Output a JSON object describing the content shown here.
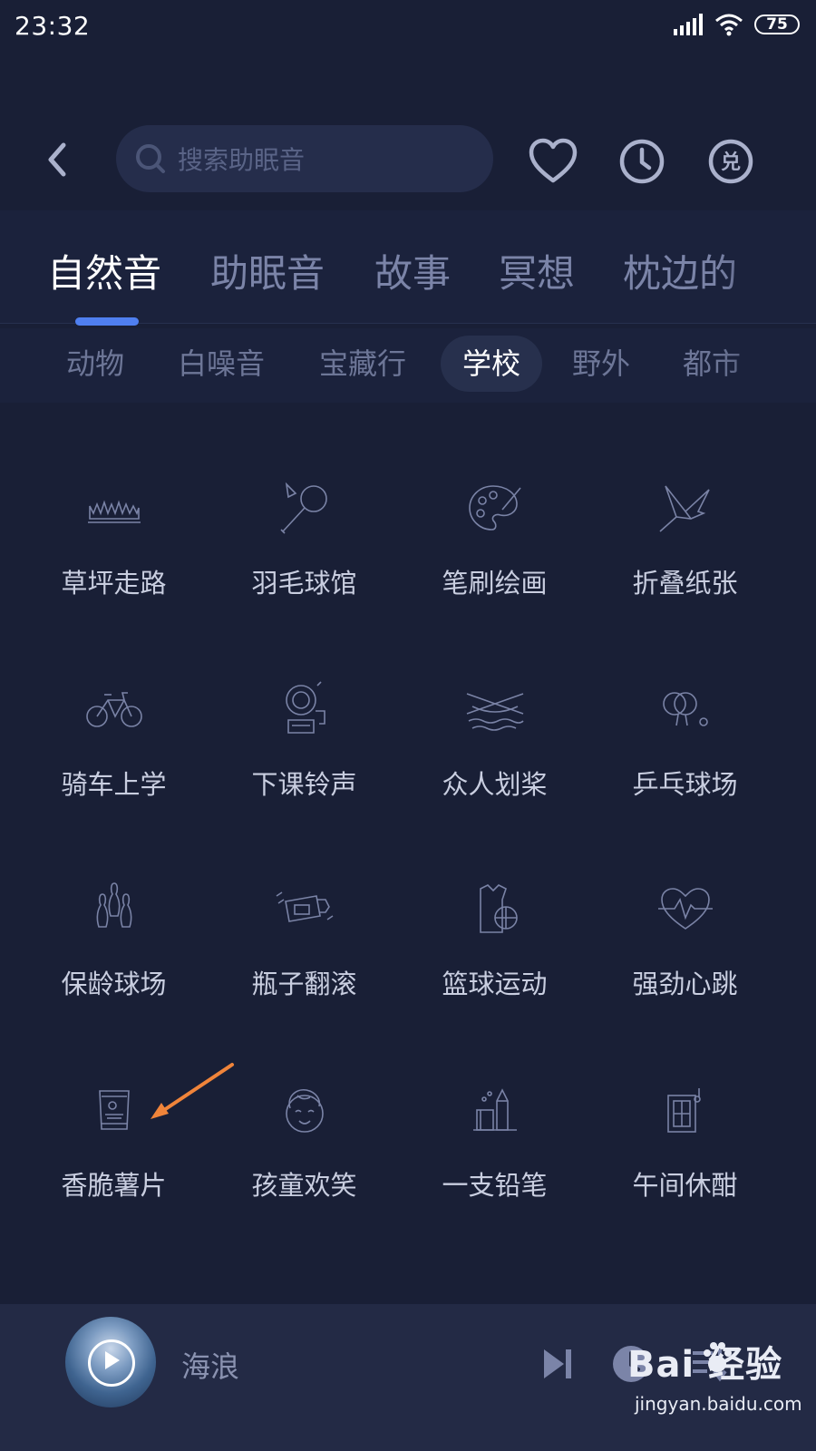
{
  "status": {
    "time": "23:32",
    "battery": "75"
  },
  "header": {
    "search_placeholder": "搜索助眠音"
  },
  "tabs": [
    {
      "label": "自然音",
      "active": true
    },
    {
      "label": "助眠音",
      "active": false
    },
    {
      "label": "故事",
      "active": false
    },
    {
      "label": "冥想",
      "active": false
    },
    {
      "label": "枕边的",
      "active": false
    }
  ],
  "chips": [
    {
      "label": "动物",
      "active": false
    },
    {
      "label": "白噪音",
      "active": false
    },
    {
      "label": "宝藏行",
      "active": false
    },
    {
      "label": "学校",
      "active": true
    },
    {
      "label": "野外",
      "active": false
    },
    {
      "label": "都市",
      "active": false
    }
  ],
  "sounds": [
    {
      "label": "草坪走路",
      "icon": "grass-icon"
    },
    {
      "label": "羽毛球馆",
      "icon": "badminton-icon"
    },
    {
      "label": "笔刷绘画",
      "icon": "palette-icon"
    },
    {
      "label": "折叠纸张",
      "icon": "paper-crane-icon"
    },
    {
      "label": "骑车上学",
      "icon": "bicycle-icon"
    },
    {
      "label": "下课铃声",
      "icon": "school-bell-icon"
    },
    {
      "label": "众人划桨",
      "icon": "rowing-boat-icon"
    },
    {
      "label": "乒乓球场",
      "icon": "ping-pong-icon"
    },
    {
      "label": "保龄球场",
      "icon": "bowling-icon"
    },
    {
      "label": "瓶子翻滚",
      "icon": "rolling-bottle-icon"
    },
    {
      "label": "篮球运动",
      "icon": "basketball-icon"
    },
    {
      "label": "强劲心跳",
      "icon": "heartbeat-icon"
    },
    {
      "label": "香脆薯片",
      "icon": "chips-bag-icon"
    },
    {
      "label": "孩童欢笑",
      "icon": "child-face-icon"
    },
    {
      "label": "一支铅笔",
      "icon": "pencil-icon"
    },
    {
      "label": "午间休酣",
      "icon": "window-note-icon"
    }
  ],
  "player": {
    "title": "海浪"
  },
  "watermark": {
    "brand": "Bai  经验",
    "url": "jingyan.baidu.com"
  },
  "colors": {
    "accent": "#4f7ff0",
    "arrow": "#f0843a",
    "background": "#191f36"
  }
}
